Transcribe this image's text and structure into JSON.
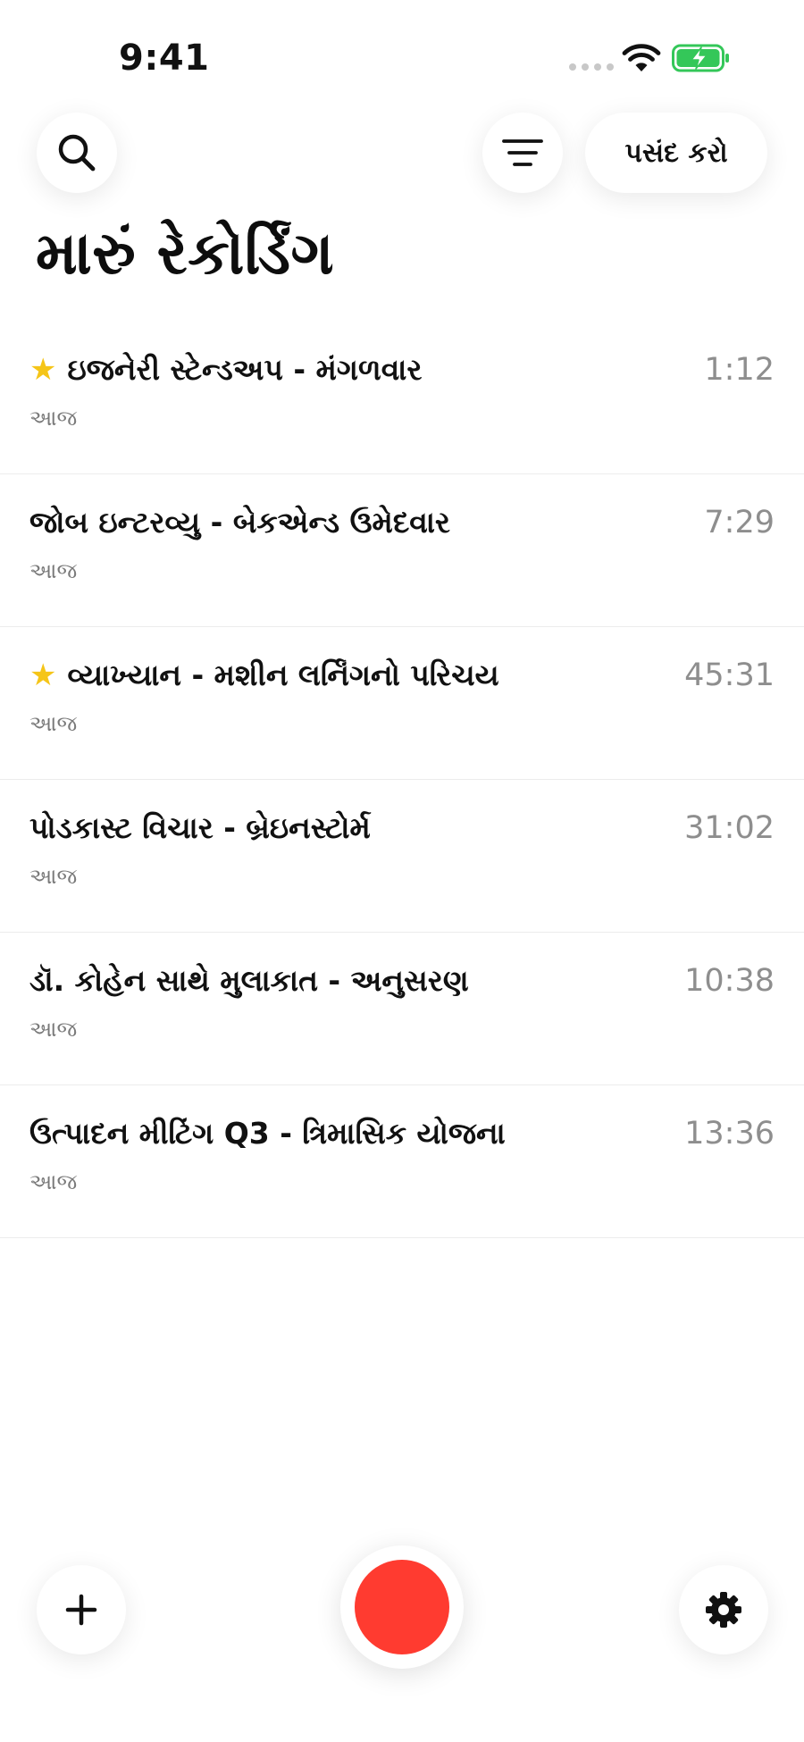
{
  "status_bar": {
    "time": "9:41",
    "icons": [
      "signal-dots",
      "wifi-icon",
      "battery-charging-icon"
    ]
  },
  "header": {
    "search_icon": "search-icon",
    "sort_icon": "sort-lines-icon",
    "select_label": "પસંદ કરો"
  },
  "page": {
    "title": "મારું રેકોર્ડિંગ"
  },
  "recordings": [
    {
      "title": "ઇજનેરી સ્ટેન્ડઅપ - મંગળવાર",
      "date": "આજ",
      "duration": "1:12",
      "starred": true
    },
    {
      "title": "જોબ ઇન્ટરવ્યુ - બેકએન્ડ ઉમેદવાર",
      "date": "આજ",
      "duration": "7:29",
      "starred": false
    },
    {
      "title": "વ્યાખ્યાન - મશીન લર્નિંગનો પરિચય",
      "date": "આજ",
      "duration": "45:31",
      "starred": true
    },
    {
      "title": "પોડકાસ્ટ વિચાર - બ્રેઇનસ્ટોર્મ",
      "date": "આજ",
      "duration": "31:02",
      "starred": false
    },
    {
      "title": "ડૉ. કોહેન સાથે મુલાકાત - અનુસરણ",
      "date": "આજ",
      "duration": "10:38",
      "starred": false
    },
    {
      "title": "ઉત્પાદન મીટિંગ Q3 - ત્રિમાસિક યોજના",
      "date": "આજ",
      "duration": "13:36",
      "starred": false
    }
  ],
  "star_glyph": "★",
  "bottom_bar": {
    "add_icon": "plus-icon",
    "record_icon": "record-icon",
    "settings_icon": "gear-icon",
    "record_color": "#ff3b30"
  },
  "colors": {
    "star": "#f5c518",
    "battery": "#34c759",
    "record": "#ff3b30"
  }
}
